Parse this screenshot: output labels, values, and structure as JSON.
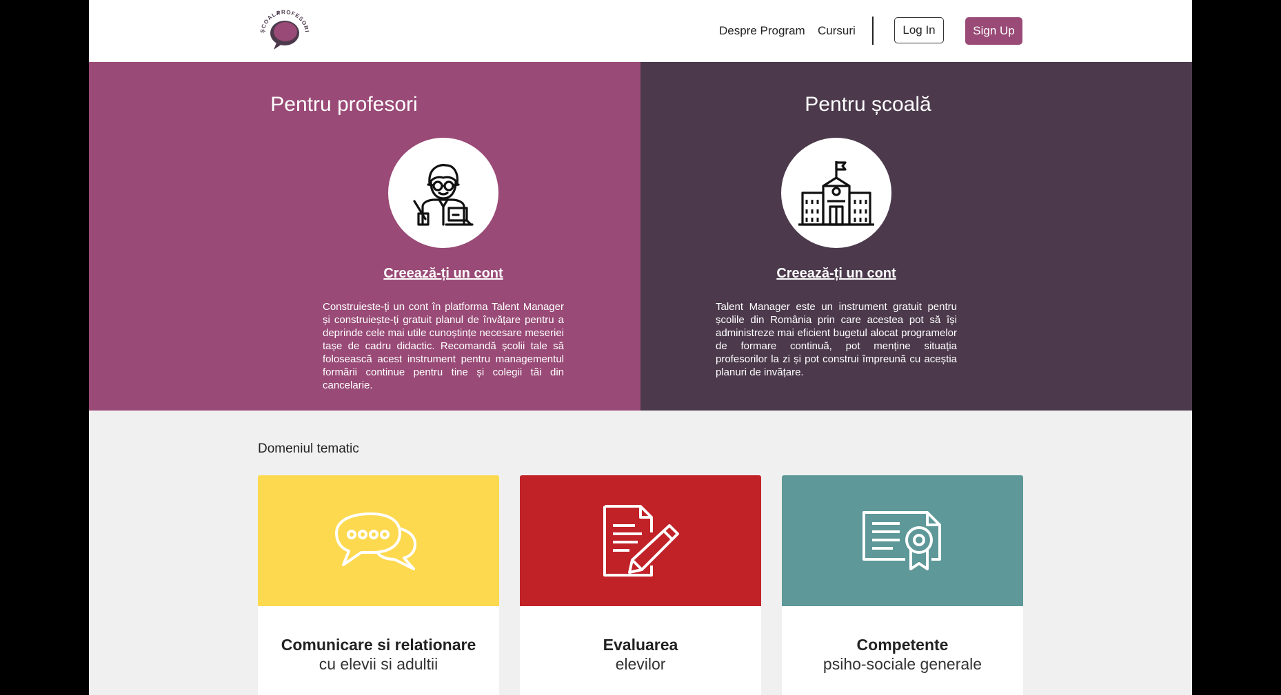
{
  "header": {
    "logo_text_top": "ȘCOALA",
    "logo_text_bottom": "PROFESORILOR",
    "nav": [
      "Despre Program",
      "Cursuri"
    ],
    "login": "Log In",
    "signup": "Sign Up"
  },
  "hero": {
    "teachers": {
      "title": "Pentru profesori",
      "icon": "teacher-icon",
      "link": "Creează-ți un cont",
      "text": "Construieste-ți un cont în platforma Talent Manager și construiește-ți gratuit planul de învățare pentru a deprinde cele mai utile cunoștințe necesare meseriei tașe de cadru didactic. Recomandă școlii tale să folosească acest instrument pentru managementul formării continue pentru tine și colegii tăi din cancelarie."
    },
    "school": {
      "title": "Pentru școală",
      "icon": "school-building-icon",
      "link": "Creează-ți un cont",
      "text": "Talent Manager este un instrument gratuit pentru școlile din România prin care acestea pot să își administreze mai eficient bugetul alocat programelor de formare continuă, pot menține situația profesorilor la zi și pot construi împreună cu aceștia planuri de invățare."
    }
  },
  "topics": {
    "title": "Domeniul tematic",
    "cards": [
      {
        "title": "Comunicare si relationare",
        "subtitle": "cu elevii si adultii",
        "color": "#fdd950",
        "icon": "speech-bubbles-icon"
      },
      {
        "title": "Evaluarea",
        "subtitle": "elevilor",
        "color": "#c12228",
        "icon": "document-pencil-icon"
      },
      {
        "title": "Competente",
        "subtitle": "psiho-sociale generale",
        "color": "#5e9898",
        "icon": "certificate-icon"
      }
    ]
  },
  "colors": {
    "primary": "#994a76",
    "dark": "#4c3a4c",
    "background": "#f0f0f0"
  }
}
